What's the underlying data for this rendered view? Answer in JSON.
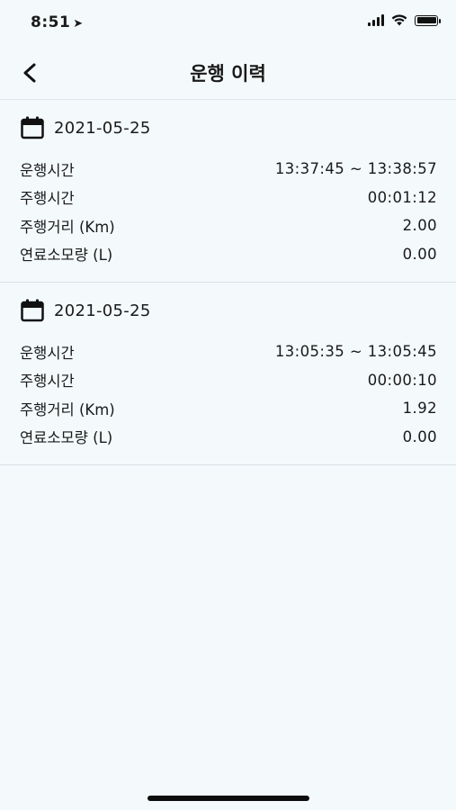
{
  "status_bar": {
    "time": "8:51"
  },
  "header": {
    "title": "운행 이력",
    "back_icon": "chevron-left-icon"
  },
  "records": [
    {
      "date": "2021-05-25",
      "rows": [
        {
          "label": "운행시간",
          "value": "13:37:45 ~ 13:38:57"
        },
        {
          "label": "주행시간",
          "value": "00:01:12"
        },
        {
          "label": "주행거리 (Km)",
          "value": "2.00"
        },
        {
          "label": "연료소모량 (L)",
          "value": "0.00"
        }
      ]
    },
    {
      "date": "2021-05-25",
      "rows": [
        {
          "label": "운행시간",
          "value": "13:05:35 ~ 13:05:45"
        },
        {
          "label": "주행시간",
          "value": "00:00:10"
        },
        {
          "label": "주행거리 (Km)",
          "value": "1.92"
        },
        {
          "label": "연료소모량 (L)",
          "value": "0.00"
        }
      ]
    }
  ]
}
